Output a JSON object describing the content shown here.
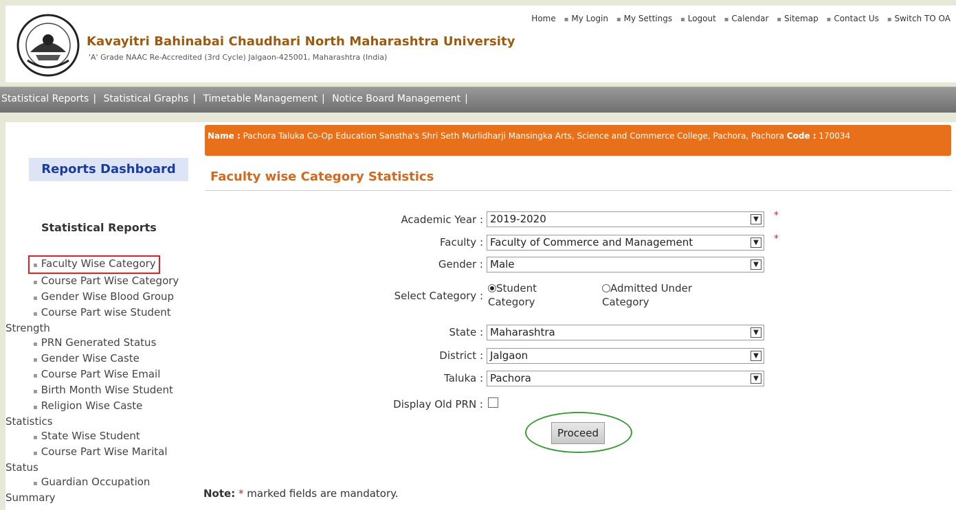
{
  "header": {
    "title": "Kavayitri Bahinabai Chaudhari North Maharashtra University",
    "subtitle": "'A' Grade NAAC Re-Accredited (3rd Cycle) Jalgaon-425001, Maharashtra (India)",
    "links": [
      "Home",
      "My Login",
      "My Settings",
      "Logout",
      "Calendar",
      "Sitemap",
      "Contact Us",
      "Switch TO OA"
    ]
  },
  "nav": [
    "Statistical Reports",
    "Statistical Graphs",
    "Timetable Management",
    "Notice Board Management"
  ],
  "sidebar": {
    "dashboard": "Reports Dashboard",
    "section_title": "Statistical Reports",
    "items": {
      "0": "Faculty Wise Category",
      "1": "Course Part Wise Category",
      "2": "Gender Wise Blood Group",
      "3a": "Course Part wise Student",
      "3b": "Strength",
      "4": "PRN Generated Status",
      "5": "Gender Wise Caste",
      "6": "Course Part Wise  Email",
      "7": "Birth Month Wise Student",
      "8a": "Religion Wise Caste",
      "8b": "Statistics",
      "9": "State Wise Student",
      "10a": "Course Part Wise Marital",
      "10b": "Status",
      "11a": "Guardian Occupation",
      "11b": "Summary"
    }
  },
  "main": {
    "name_label": "Name :",
    "college_name": "Pachora Taluka Co-Op Education Sanstha's Shri Seth Murlidharji Mansingka Arts, Science and Commerce College, Pachora, Pachora",
    "code_label": "Code :",
    "code": "170034",
    "title": "Faculty wise Category Statistics"
  },
  "form": {
    "required_marker": "*",
    "academic_year": {
      "label": "Academic Year :",
      "value": "2019-2020"
    },
    "faculty": {
      "label": "Faculty :",
      "value": "Faculty of Commerce and Management"
    },
    "gender": {
      "label": "Gender :",
      "value": "Male"
    },
    "category": {
      "label": "Select Category :",
      "option1a": "Student",
      "option1b": "Category",
      "option2a": "Admitted Under",
      "option2b": "Category",
      "selected": "Student Category"
    },
    "state": {
      "label": "State :",
      "value": "Maharashtra"
    },
    "district": {
      "label": "District :",
      "value": "Jalgaon"
    },
    "taluka": {
      "label": "Taluka :",
      "value": "Pachora"
    },
    "old_prn": {
      "label": "Display Old PRN :",
      "checked": false
    },
    "proceed": "Proceed",
    "note_label": "Note:",
    "note_text": "marked fields are mandatory."
  }
}
